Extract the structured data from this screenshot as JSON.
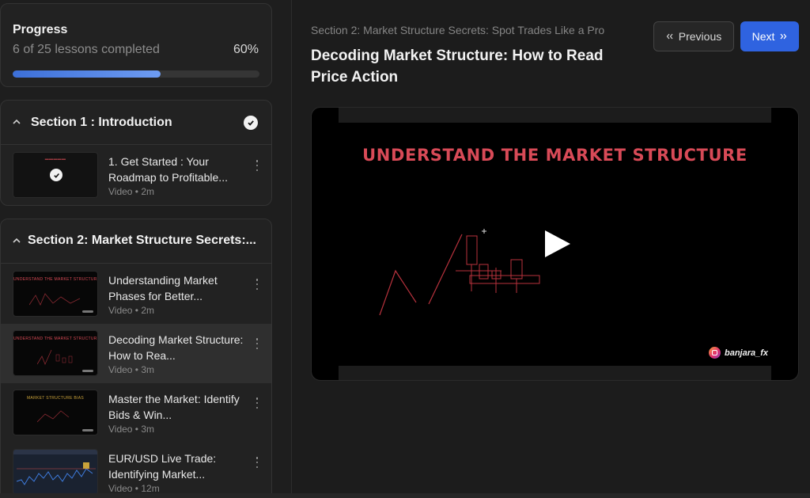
{
  "progress": {
    "title": "Progress",
    "summary": "6 of 25 lessons completed",
    "percent_label": "60%",
    "percent": 60
  },
  "sections": [
    {
      "title": "Section 1 : Introduction",
      "completed": true,
      "lessons": [
        {
          "title": "1. Get Started : Your Roadmap to Profitable...",
          "meta": "Video • 2m",
          "completed": true
        }
      ]
    },
    {
      "title": "Section 2: Market Structure Secrets:...",
      "lessons": [
        {
          "title": "Understanding Market Phases for Better...",
          "meta": "Video • 2m",
          "thumb_text": "UNDERSTAND THE MARKET STRUCTURE"
        },
        {
          "title": "Decoding Market Structure: How to Rea...",
          "meta": "Video • 3m",
          "thumb_text": "UNDERSTAND THE MARKET STRUCTURE",
          "active": true
        },
        {
          "title": "Master the Market: Identify Bids & Win...",
          "meta": "Video • 3m",
          "thumb_text": "MARKET STRUCTURE BIAS"
        },
        {
          "title": "EUR/USD Live Trade: Identifying Market...",
          "meta": "Video • 12m"
        }
      ]
    }
  ],
  "main": {
    "breadcrumb": "Section 2: Market Structure Secrets: Spot Trades Like a Pro",
    "title": "Decoding Market Structure: How to Read Price Action",
    "prev_label": "Previous",
    "next_label": "Next"
  },
  "video": {
    "heading": "UNDERSTAND THE MARKET STRUCTURE",
    "watermark": "banjara_fx"
  },
  "colors": {
    "accent": "#2f63e0",
    "video_red": "#d84a57"
  }
}
